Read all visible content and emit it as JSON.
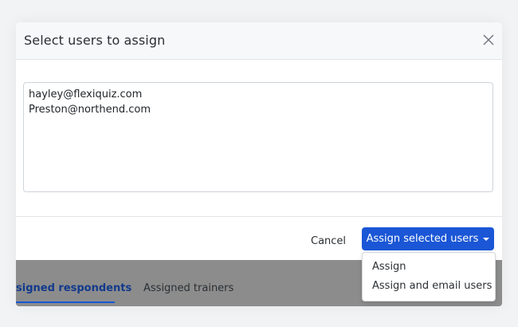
{
  "modal": {
    "title": "Select users to assign",
    "close_icon": "close-icon",
    "textarea_value": "hayley@flexiquiz.com\nPreston@northend.com"
  },
  "footer": {
    "cancel_label": "Cancel",
    "assign_label": "Assign selected users",
    "assign_color": "#1a56d6"
  },
  "dropdown": {
    "items": [
      {
        "label": "Assign"
      },
      {
        "label": "Assign and email users"
      }
    ]
  },
  "background_tabs": [
    {
      "label": "signed respondents",
      "active": true
    },
    {
      "label": "Assigned trainers",
      "active": false
    }
  ]
}
